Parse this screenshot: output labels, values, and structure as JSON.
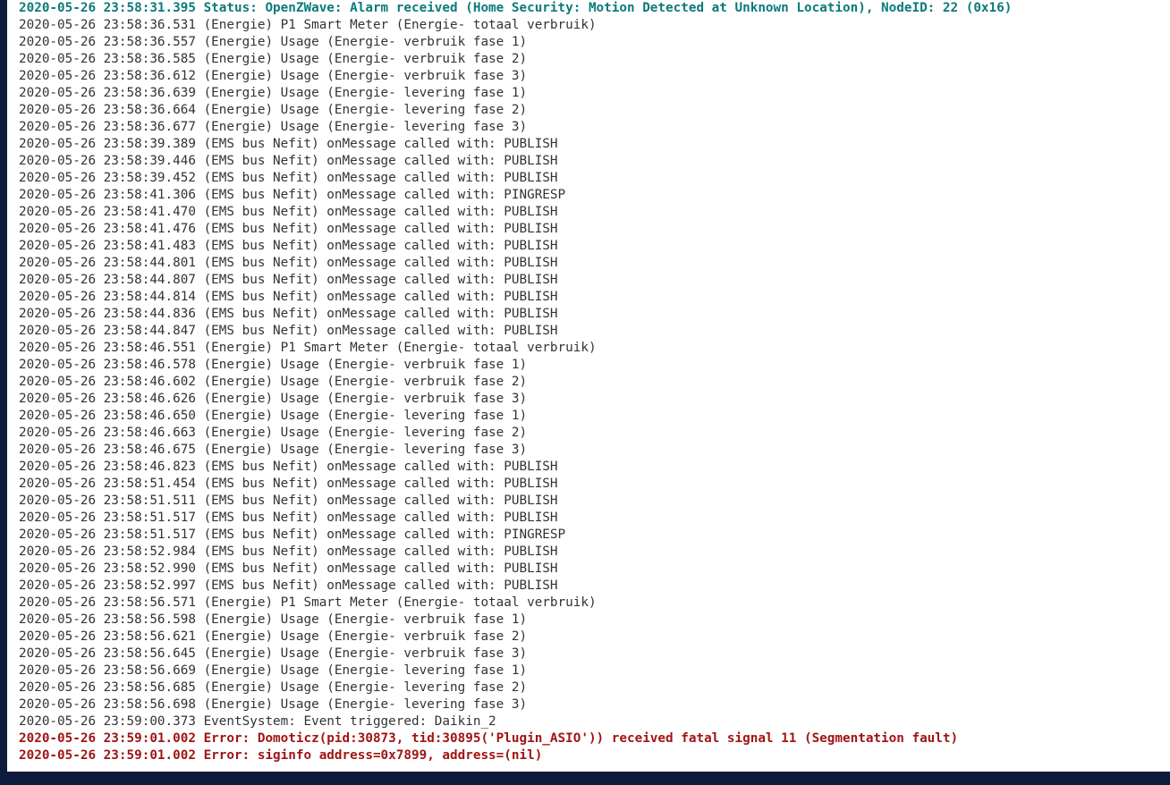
{
  "log": {
    "lines": [
      {
        "text": "2020-05-26 23:58:31.395 Status: OpenZWave: Alarm received (Home Security: Motion Detected at Unknown Location), NodeID: 22 (0x16)",
        "level": "status"
      },
      {
        "text": "2020-05-26 23:58:36.531 (Energie) P1 Smart Meter (Energie- totaal verbruik)",
        "level": "normal"
      },
      {
        "text": "2020-05-26 23:58:36.557 (Energie) Usage (Energie- verbruik fase 1)",
        "level": "normal"
      },
      {
        "text": "2020-05-26 23:58:36.585 (Energie) Usage (Energie- verbruik fase 2)",
        "level": "normal"
      },
      {
        "text": "2020-05-26 23:58:36.612 (Energie) Usage (Energie- verbruik fase 3)",
        "level": "normal"
      },
      {
        "text": "2020-05-26 23:58:36.639 (Energie) Usage (Energie- levering fase 1)",
        "level": "normal"
      },
      {
        "text": "2020-05-26 23:58:36.664 (Energie) Usage (Energie- levering fase 2)",
        "level": "normal"
      },
      {
        "text": "2020-05-26 23:58:36.677 (Energie) Usage (Energie- levering fase 3)",
        "level": "normal"
      },
      {
        "text": "2020-05-26 23:58:39.389 (EMS bus Nefit) onMessage called with: PUBLISH",
        "level": "normal"
      },
      {
        "text": "2020-05-26 23:58:39.446 (EMS bus Nefit) onMessage called with: PUBLISH",
        "level": "normal"
      },
      {
        "text": "2020-05-26 23:58:39.452 (EMS bus Nefit) onMessage called with: PUBLISH",
        "level": "normal"
      },
      {
        "text": "2020-05-26 23:58:41.306 (EMS bus Nefit) onMessage called with: PINGRESP",
        "level": "normal"
      },
      {
        "text": "2020-05-26 23:58:41.470 (EMS bus Nefit) onMessage called with: PUBLISH",
        "level": "normal"
      },
      {
        "text": "2020-05-26 23:58:41.476 (EMS bus Nefit) onMessage called with: PUBLISH",
        "level": "normal"
      },
      {
        "text": "2020-05-26 23:58:41.483 (EMS bus Nefit) onMessage called with: PUBLISH",
        "level": "normal"
      },
      {
        "text": "2020-05-26 23:58:44.801 (EMS bus Nefit) onMessage called with: PUBLISH",
        "level": "normal"
      },
      {
        "text": "2020-05-26 23:58:44.807 (EMS bus Nefit) onMessage called with: PUBLISH",
        "level": "normal"
      },
      {
        "text": "2020-05-26 23:58:44.814 (EMS bus Nefit) onMessage called with: PUBLISH",
        "level": "normal"
      },
      {
        "text": "2020-05-26 23:58:44.836 (EMS bus Nefit) onMessage called with: PUBLISH",
        "level": "normal"
      },
      {
        "text": "2020-05-26 23:58:44.847 (EMS bus Nefit) onMessage called with: PUBLISH",
        "level": "normal"
      },
      {
        "text": "2020-05-26 23:58:46.551 (Energie) P1 Smart Meter (Energie- totaal verbruik)",
        "level": "normal"
      },
      {
        "text": "2020-05-26 23:58:46.578 (Energie) Usage (Energie- verbruik fase 1)",
        "level": "normal"
      },
      {
        "text": "2020-05-26 23:58:46.602 (Energie) Usage (Energie- verbruik fase 2)",
        "level": "normal"
      },
      {
        "text": "2020-05-26 23:58:46.626 (Energie) Usage (Energie- verbruik fase 3)",
        "level": "normal"
      },
      {
        "text": "2020-05-26 23:58:46.650 (Energie) Usage (Energie- levering fase 1)",
        "level": "normal"
      },
      {
        "text": "2020-05-26 23:58:46.663 (Energie) Usage (Energie- levering fase 2)",
        "level": "normal"
      },
      {
        "text": "2020-05-26 23:58:46.675 (Energie) Usage (Energie- levering fase 3)",
        "level": "normal"
      },
      {
        "text": "2020-05-26 23:58:46.823 (EMS bus Nefit) onMessage called with: PUBLISH",
        "level": "normal"
      },
      {
        "text": "2020-05-26 23:58:51.454 (EMS bus Nefit) onMessage called with: PUBLISH",
        "level": "normal"
      },
      {
        "text": "2020-05-26 23:58:51.511 (EMS bus Nefit) onMessage called with: PUBLISH",
        "level": "normal"
      },
      {
        "text": "2020-05-26 23:58:51.517 (EMS bus Nefit) onMessage called with: PUBLISH",
        "level": "normal"
      },
      {
        "text": "2020-05-26 23:58:51.517 (EMS bus Nefit) onMessage called with: PINGRESP",
        "level": "normal"
      },
      {
        "text": "2020-05-26 23:58:52.984 (EMS bus Nefit) onMessage called with: PUBLISH",
        "level": "normal"
      },
      {
        "text": "2020-05-26 23:58:52.990 (EMS bus Nefit) onMessage called with: PUBLISH",
        "level": "normal"
      },
      {
        "text": "2020-05-26 23:58:52.997 (EMS bus Nefit) onMessage called with: PUBLISH",
        "level": "normal"
      },
      {
        "text": "2020-05-26 23:58:56.571 (Energie) P1 Smart Meter (Energie- totaal verbruik)",
        "level": "normal"
      },
      {
        "text": "2020-05-26 23:58:56.598 (Energie) Usage (Energie- verbruik fase 1)",
        "level": "normal"
      },
      {
        "text": "2020-05-26 23:58:56.621 (Energie) Usage (Energie- verbruik fase 2)",
        "level": "normal"
      },
      {
        "text": "2020-05-26 23:58:56.645 (Energie) Usage (Energie- verbruik fase 3)",
        "level": "normal"
      },
      {
        "text": "2020-05-26 23:58:56.669 (Energie) Usage (Energie- levering fase 1)",
        "level": "normal"
      },
      {
        "text": "2020-05-26 23:58:56.685 (Energie) Usage (Energie- levering fase 2)",
        "level": "normal"
      },
      {
        "text": "2020-05-26 23:58:56.698 (Energie) Usage (Energie- levering fase 3)",
        "level": "normal"
      },
      {
        "text": "2020-05-26 23:59:00.373 EventSystem: Event triggered: Daikin_2",
        "level": "normal"
      },
      {
        "text": "2020-05-26 23:59:01.002 Error: Domoticz(pid:30873, tid:30895('Plugin_ASIO')) received fatal signal 11 (Segmentation fault)",
        "level": "error"
      },
      {
        "text": "2020-05-26 23:59:01.002 Error: siginfo address=0x7899, address=(nil)",
        "level": "error"
      }
    ]
  },
  "colors": {
    "page_background": "#0d1b3d",
    "panel_background": "#ffffff",
    "normal_text": "#333333",
    "status_text": "#0b7a7a",
    "error_text": "#a01414"
  }
}
